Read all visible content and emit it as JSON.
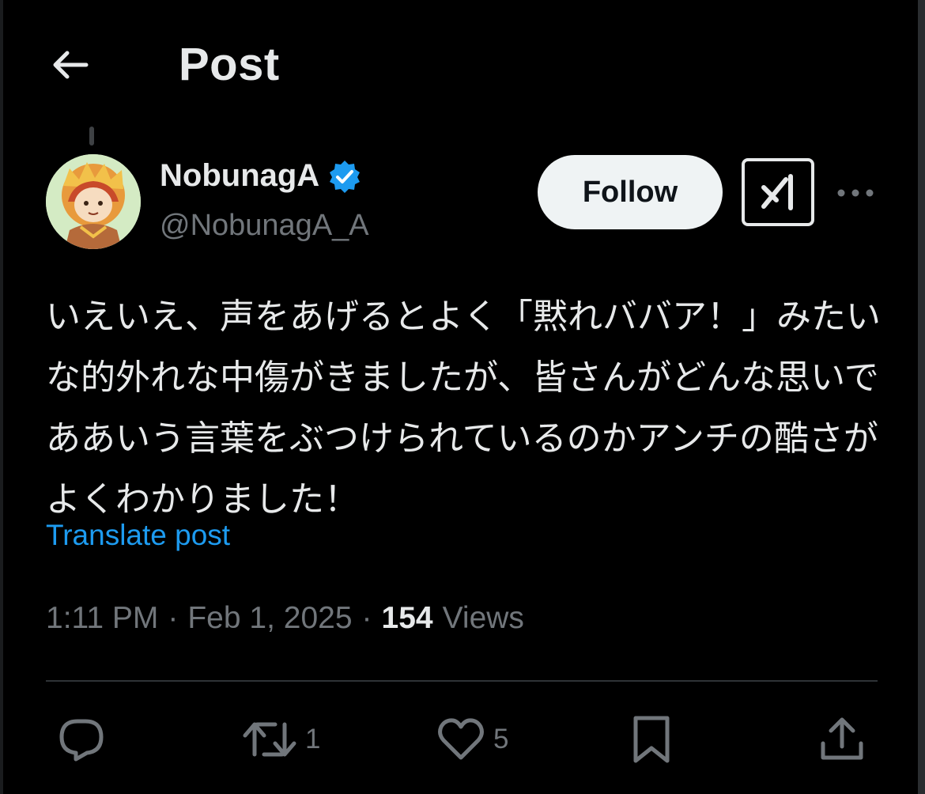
{
  "header": {
    "title": "Post",
    "back_icon": "arrow-left-icon"
  },
  "author": {
    "display_name": "NobunagA",
    "handle": "@NobunagA_A",
    "verified": true,
    "verified_color": "#1d9bf0",
    "avatar_icon": "avatar-illustration"
  },
  "actions_top": {
    "follow_label": "Follow",
    "grok_icon": "grok-icon",
    "more_icon": "more-horizontal-icon"
  },
  "post": {
    "text": "いえいえ、声をあげるとよく「黙れババア！」みたいな的外れな中傷がきましたが、皆さんがどんな思いでああいう言葉をぶつけられているのかアンチの酷さがよくわかりました！",
    "translate_label": "Translate post",
    "time": "1:11 PM",
    "date": "Feb 1, 2025",
    "separator": "·",
    "views_count": "154",
    "views_label": "Views"
  },
  "action_bar": {
    "reply": {
      "icon": "reply-icon",
      "count": ""
    },
    "repost": {
      "icon": "repost-icon",
      "count": "1"
    },
    "like": {
      "icon": "heart-icon",
      "count": "5"
    },
    "bookmark": {
      "icon": "bookmark-icon",
      "count": ""
    },
    "share": {
      "icon": "share-icon",
      "count": ""
    }
  },
  "colors": {
    "background": "#000000",
    "text_primary": "#e7e9ea",
    "text_secondary": "#71767b",
    "link": "#1d9bf0"
  }
}
